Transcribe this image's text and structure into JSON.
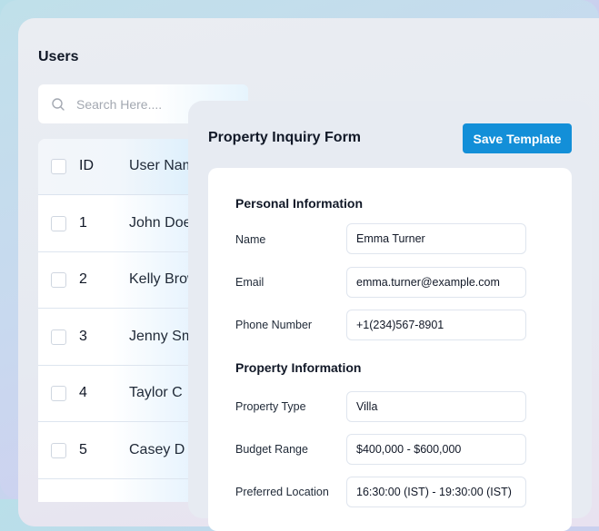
{
  "users": {
    "title": "Users",
    "search": {
      "placeholder": "Search Here....",
      "icon": "search-icon"
    },
    "columns": [
      "ID",
      "User Name"
    ],
    "rows": [
      {
        "id": "1",
        "name": "John Doe"
      },
      {
        "id": "2",
        "name": "Kelly Brown"
      },
      {
        "id": "3",
        "name": "Jenny Smith"
      },
      {
        "id": "4",
        "name": "Taylor C"
      },
      {
        "id": "5",
        "name": "Casey D"
      }
    ]
  },
  "form": {
    "title": "Property Inquiry Form",
    "save_label": "Save Template",
    "accent": "#138fd8",
    "sections": {
      "personal": "Personal Information",
      "property": "Property Information"
    },
    "fields": {
      "name": {
        "label": "Name",
        "value": "Emma Turner"
      },
      "email": {
        "label": "Email",
        "value": "emma.turner@example.com"
      },
      "phone": {
        "label": "Phone Number",
        "value": "+1(234)567-8901"
      },
      "type": {
        "label": "Property Type",
        "value": "Villa"
      },
      "budget": {
        "label": "Budget Range",
        "value": "$400,000 - $600,000"
      },
      "location": {
        "label": "Preferred Location",
        "value": "16:30:00 (IST) - 19:30:00 (IST)"
      }
    }
  }
}
